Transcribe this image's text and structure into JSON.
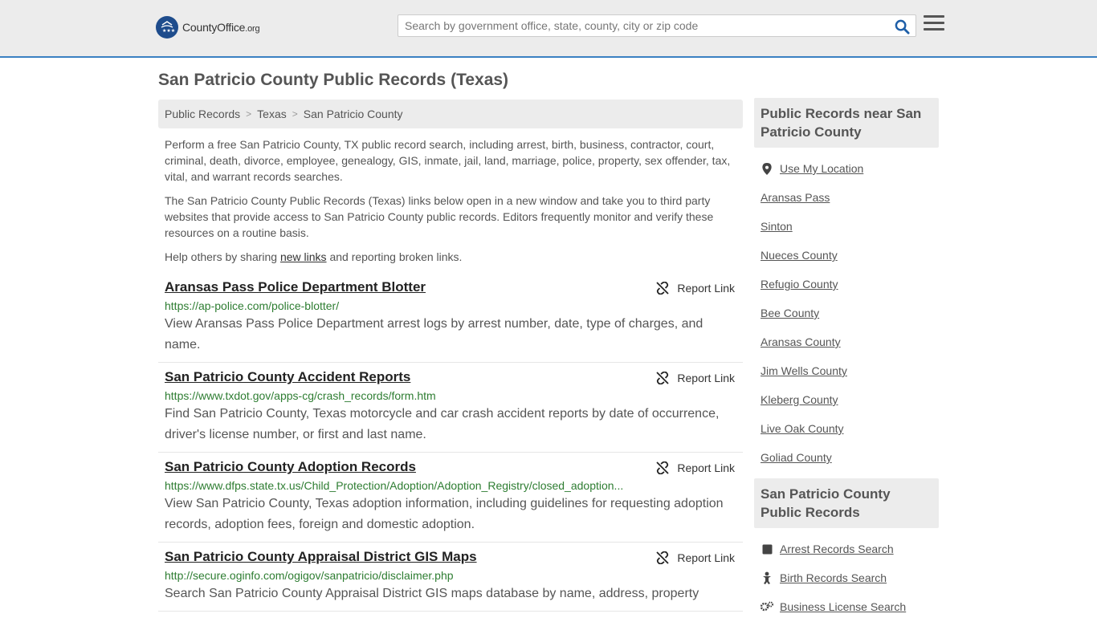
{
  "header": {
    "logo_main": "CountyOffice",
    "logo_domain": ".org",
    "search_placeholder": "Search by government office, state, county, city or zip code"
  },
  "page_title": "San Patricio County Public Records (Texas)",
  "breadcrumb": [
    "Public Records",
    "Texas",
    "San Patricio County"
  ],
  "intro": {
    "p1": "Perform a free San Patricio County, TX public record search, including arrest, birth, business, contractor, court, criminal, death, divorce, employee, genealogy, GIS, inmate, jail, land, marriage, police, property, sex offender, tax, vital, and warrant records searches.",
    "p2": "The San Patricio County Public Records (Texas) links below open in a new window and take you to third party websites that provide access to San Patricio County public records. Editors frequently monitor and verify these resources on a routine basis.",
    "p3_before": "Help others by sharing ",
    "p3_link": "new links",
    "p3_after": " and reporting broken links."
  },
  "report_label": "Report Link",
  "records": [
    {
      "title": "Aransas Pass Police Department Blotter",
      "url": "https://ap-police.com/police-blotter/",
      "desc": "View Aransas Pass Police Department arrest logs by arrest number, date, type of charges, and name."
    },
    {
      "title": "San Patricio County Accident Reports",
      "url": "https://www.txdot.gov/apps-cg/crash_records/form.htm",
      "desc": "Find San Patricio County, Texas motorcycle and car crash accident reports by date of occurrence, driver's license number, or first and last name."
    },
    {
      "title": "San Patricio County Adoption Records",
      "url": "https://www.dfps.state.tx.us/Child_Protection/Adoption/Adoption_Registry/closed_adoption...",
      "desc": "View San Patricio County, Texas adoption information, including guidelines for requesting adoption records, adoption fees, foreign and domestic adoption."
    },
    {
      "title": "San Patricio County Appraisal District GIS Maps",
      "url": "http://secure.oginfo.com/ogigov/sanpatricio/disclaimer.php",
      "desc": "Search San Patricio County Appraisal District GIS maps database by name, address, property"
    }
  ],
  "sidebar": {
    "near_heading": "Public Records near San Patricio County",
    "use_location": "Use My Location",
    "near_items": [
      "Aransas Pass",
      "Sinton",
      "Nueces County",
      "Refugio County",
      "Bee County",
      "Aransas County",
      "Jim Wells County",
      "Kleberg County",
      "Live Oak County",
      "Goliad County"
    ],
    "records_heading": "San Patricio County Public Records",
    "records_items": [
      "Arrest Records Search",
      "Birth Records Search",
      "Business License Search"
    ]
  },
  "colors": {
    "accent": "#3a80c2",
    "url_green": "#2e7d32",
    "header_bg": "#ececec"
  }
}
